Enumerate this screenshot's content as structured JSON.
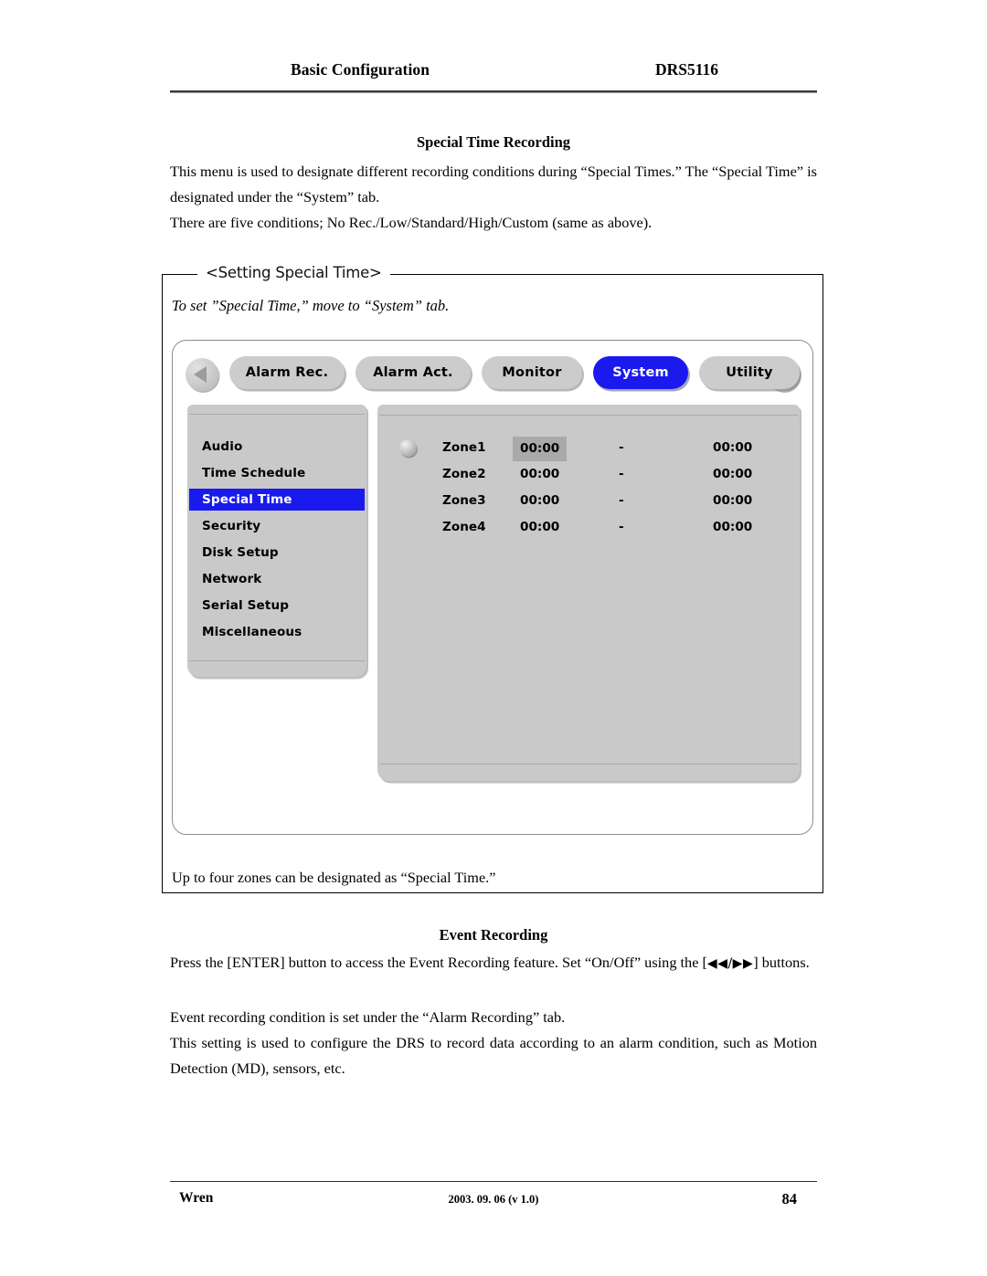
{
  "header": {
    "left_title": "Basic Configuration",
    "right_title": "DRS5116"
  },
  "sections": {
    "special_time": {
      "title": "Special Time Recording",
      "paragraph_1": "This menu is used to designate different recording conditions during “Special Times.”   The “Special Time” is designated under the “System” tab.",
      "paragraph_2": "There are five conditions; No Rec./Low/Standard/High/Custom (same as above)."
    },
    "event_recording": {
      "title": "Event Recording",
      "paragraph_1_before": "Press the [ENTER] button to access the Event Recording feature.   Set “On/Off” using the [",
      "paragraph_1_arrows": "◀◀/▶▶",
      "paragraph_1_after": "] buttons.",
      "paragraph_2": "Event recording condition is set under the “Alarm Recording” tab.",
      "paragraph_3": "This setting is used to configure the DRS to record data according to an alarm condition, such as Motion Detection (MD), sensors, etc."
    }
  },
  "figure": {
    "legend": "<Setting Special Time>",
    "note": "To set ”Special Time,” move to “System” tab.",
    "caption": "Up to four zones can be designated as “Special Time.”"
  },
  "device_ui": {
    "nav": {
      "prev_icon": "left-triangle-icon",
      "next_icon": "blank-circle-icon"
    },
    "tabs": [
      {
        "label": "Alarm Rec.",
        "active": false
      },
      {
        "label": "Alarm Act.",
        "active": false
      },
      {
        "label": "Monitor",
        "active": false
      },
      {
        "label": "System",
        "active": true
      },
      {
        "label": "Utility",
        "active": false
      }
    ],
    "sidebar": {
      "items": [
        {
          "label": "Audio",
          "selected": false
        },
        {
          "label": "Time Schedule",
          "selected": false
        },
        {
          "label": "Special Time",
          "selected": true
        },
        {
          "label": "Security",
          "selected": false
        },
        {
          "label": "Disk Setup",
          "selected": false
        },
        {
          "label": "Network",
          "selected": false
        },
        {
          "label": "Serial Setup",
          "selected": false
        },
        {
          "label": "Miscellaneous",
          "selected": false
        }
      ]
    },
    "zones": {
      "separator": "-",
      "rows": [
        {
          "name": "Zone1",
          "start": "00:00",
          "end": "00:00",
          "highlight_start": true
        },
        {
          "name": "Zone2",
          "start": "00:00",
          "end": "00:00",
          "highlight_start": false
        },
        {
          "name": "Zone3",
          "start": "00:00",
          "end": "00:00",
          "highlight_start": false
        },
        {
          "name": "Zone4",
          "start": "00:00",
          "end": "00:00",
          "highlight_start": false
        }
      ]
    },
    "colors": {
      "accent_blue": "#1a1aee",
      "panel_gray": "#c9c9c9",
      "tab_gray": "#cccccc",
      "field_highlight_gray": "#a9a9a9"
    }
  },
  "footer": {
    "left": "Wren",
    "center": "2003. 09. 06 (v 1.0)",
    "page_number": "84"
  }
}
